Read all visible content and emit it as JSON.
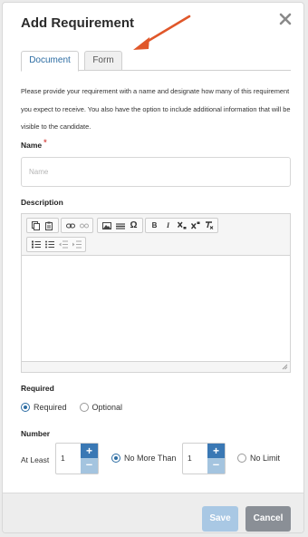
{
  "modal": {
    "title": "Add Requirement",
    "intro": "Please provide your requirement with a name and designate how many of this requirement you expect to receive. You also have the option to include additional information that will be visible to the candidate."
  },
  "tabs": [
    {
      "label": "Document",
      "active": true
    },
    {
      "label": "Form",
      "active": false
    }
  ],
  "name_field": {
    "label": "Name",
    "required_marker": "*",
    "placeholder": "Name",
    "value": ""
  },
  "description": {
    "label": "Description",
    "toolbar_row1": [
      "copy-icon",
      "paste-icon",
      "link-icon",
      "unlink-icon",
      "image-icon",
      "horizontal-line-icon",
      "special-char-icon",
      "bold-icon",
      "italic-icon",
      "subscript-icon",
      "superscript-icon",
      "remove-format-icon"
    ],
    "toolbar_row2": [
      "numbered-list-icon",
      "bulleted-list-icon",
      "decrease-indent-icon",
      "increase-indent-icon"
    ],
    "glyphs": {
      "special_char": "Ω",
      "bold": "B",
      "italic": "I"
    }
  },
  "required_section": {
    "label": "Required",
    "options": [
      {
        "label": "Required",
        "checked": true
      },
      {
        "label": "Optional",
        "checked": false
      }
    ]
  },
  "number_section": {
    "label": "Number",
    "at_least_label": "At Least",
    "at_least_value": "1",
    "max_value": "1",
    "no_more_than_label": "No More Than",
    "no_more_than_checked": true,
    "no_limit_label": "No Limit",
    "no_limit_checked": false,
    "plus_glyph": "+",
    "minus_glyph": "–"
  },
  "footer": {
    "save_label": "Save",
    "cancel_label": "Cancel"
  },
  "colors": {
    "accent": "#2d6da3",
    "annotation_arrow": "#e0572a",
    "save_disabled": "#a9c8e4",
    "cancel": "#8a8f96"
  }
}
